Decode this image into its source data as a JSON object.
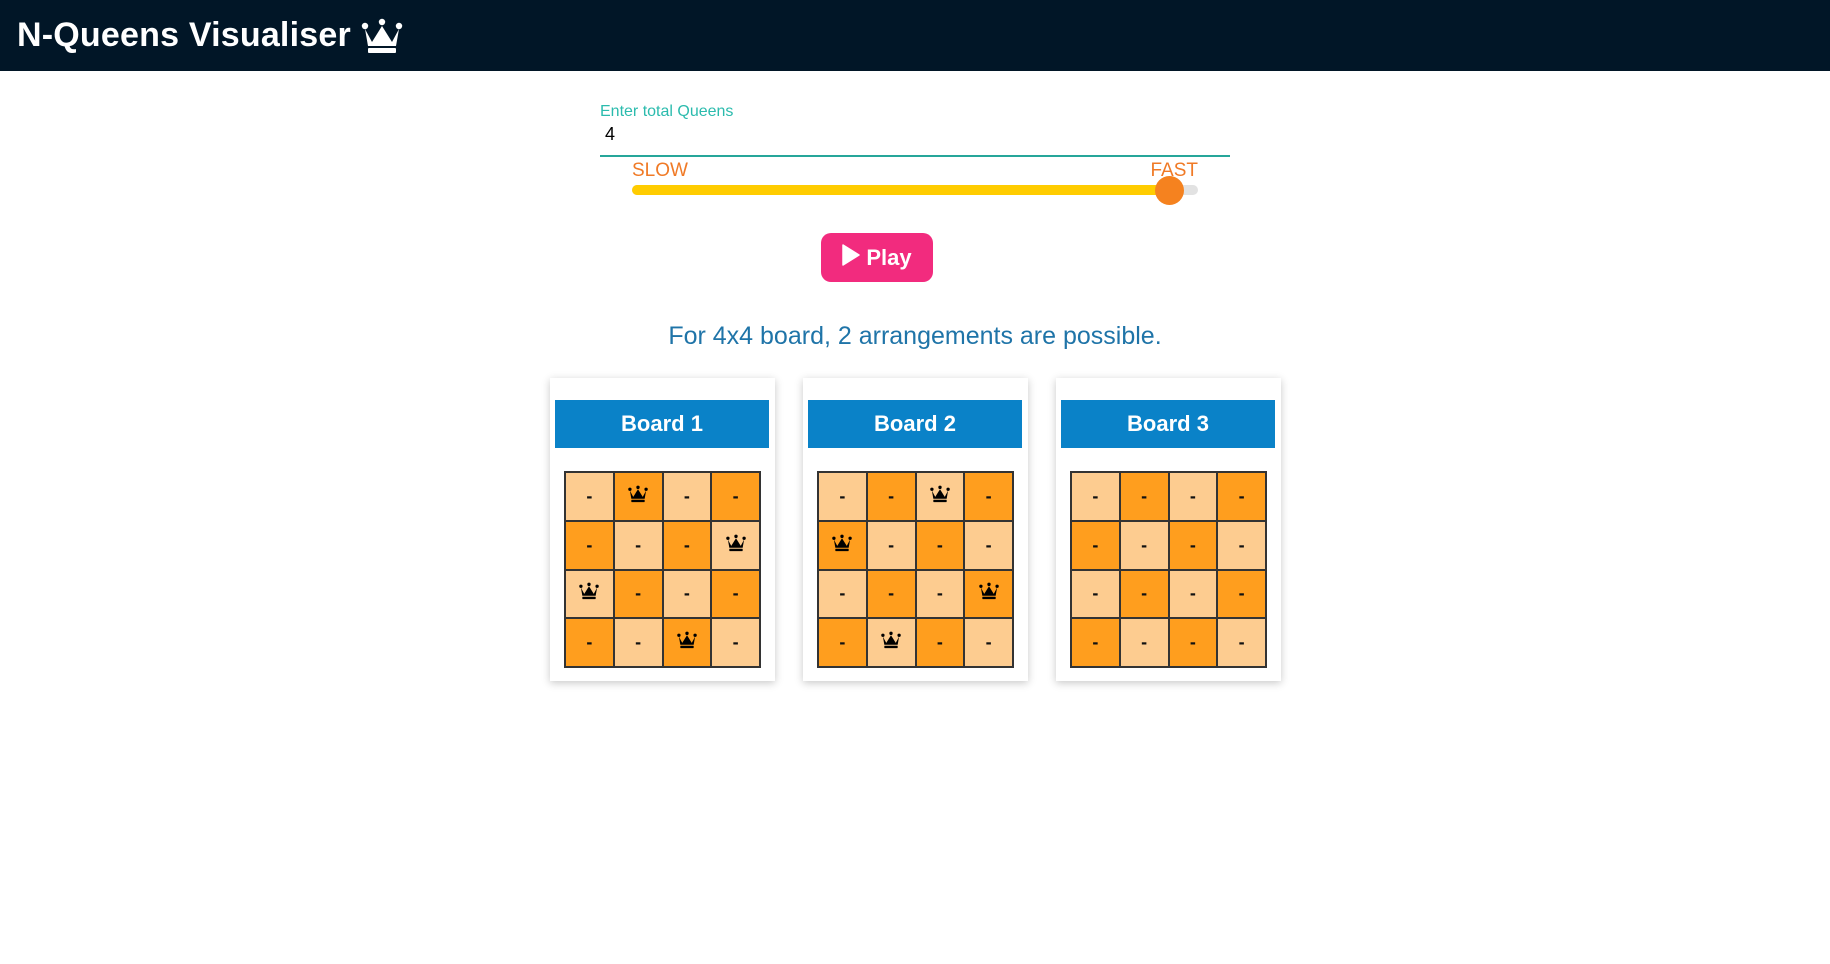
{
  "app": {
    "title": "N-Queens Visualiser",
    "title_icon": "crown-icon"
  },
  "controls": {
    "input_label": "Enter total Queens",
    "input_value": "4",
    "speed_slow_label": "SLOW",
    "speed_fast_label": "FAST",
    "speed_value": 0.95,
    "play_label": "Play",
    "play_icon": "play-icon"
  },
  "result_text": "For 4x4 board, 2 arrangements are possible.",
  "colors": {
    "navbar": "#011627",
    "accent_teal": "#26a69a",
    "slider_fill": "#ffcc00",
    "slider_thumb": "#f5821f",
    "play_button": "#f22b7e",
    "board_header": "#0a82c8",
    "cell_light": "#fdcc90",
    "cell_dark": "#ff9e1e"
  },
  "empty_cell_symbol": "-",
  "queen_icon": "queen-icon",
  "boards": [
    {
      "title": "Board 1",
      "rows": [
        [
          "-",
          "Q",
          "-",
          "-"
        ],
        [
          "-",
          "-",
          "-",
          "Q"
        ],
        [
          "Q",
          "-",
          "-",
          "-"
        ],
        [
          "-",
          "-",
          "Q",
          "-"
        ]
      ]
    },
    {
      "title": "Board 2",
      "rows": [
        [
          "-",
          "-",
          "Q",
          "-"
        ],
        [
          "Q",
          "-",
          "-",
          "-"
        ],
        [
          "-",
          "-",
          "-",
          "Q"
        ],
        [
          "-",
          "Q",
          "-",
          "-"
        ]
      ]
    },
    {
      "title": "Board 3",
      "rows": [
        [
          "-",
          "-",
          "-",
          "-"
        ],
        [
          "-",
          "-",
          "-",
          "-"
        ],
        [
          "-",
          "-",
          "-",
          "-"
        ],
        [
          "-",
          "-",
          "-",
          "-"
        ]
      ]
    }
  ]
}
